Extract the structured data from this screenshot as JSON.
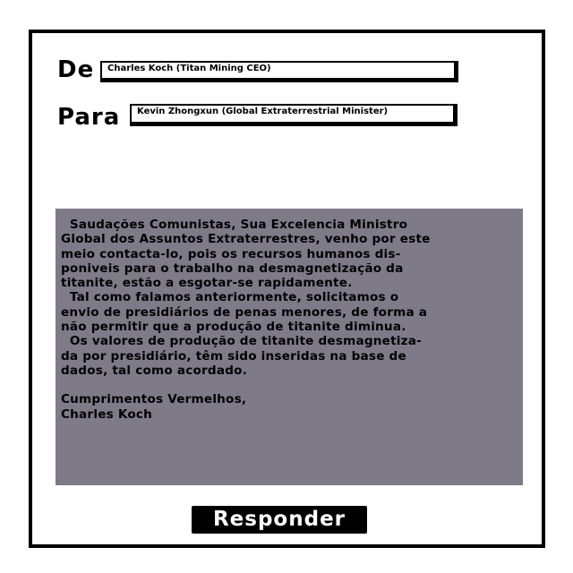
{
  "header": {
    "from_label": "De",
    "to_label": "Para",
    "from_value": "Charles Koch (Titan Mining CEO)",
    "to_value": "Kevin Zhongxun (Global Extraterrestrial Minister)"
  },
  "message": {
    "lines": [
      "  Saudações Comunistas, Sua Excelencia Ministro",
      "Global dos Assuntos Extraterrestres, venho por este",
      "meio contacta-lo, pois os recursos humanos dis-",
      "poniveis para o trabalho na desmagnetização da",
      "titanite, estão a esgotar-se rapidamente.",
      "  Tal como falamos anteriormente, solicitamos o",
      "envio de presidiários de penas menores, de forma a",
      "não permitir que a produção de titanite diminua.",
      "  Os valores de produção de titanite desmagnetiza-",
      "da por presidiário, têm sido inseridas na base de",
      "dados, tal como acordado."
    ],
    "closing_lines": [
      "Cumprimentos Vermelhos,",
      "Charles Koch"
    ]
  },
  "actions": {
    "reply_label": "Responder"
  },
  "colors": {
    "panel_background": "#7f7a88",
    "frame": "#000000",
    "button_background": "#000000",
    "button_text": "#ffffff"
  }
}
